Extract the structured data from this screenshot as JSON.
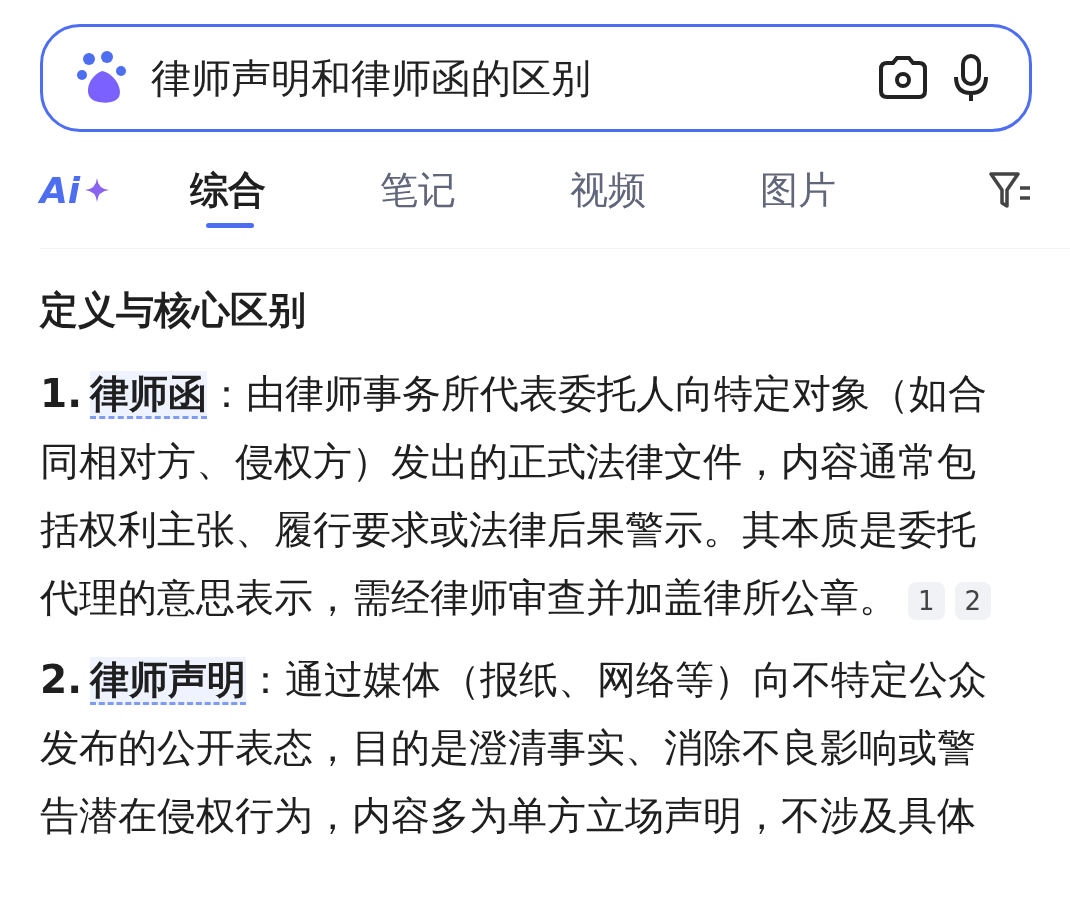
{
  "search": {
    "value": "律师声明和律师函的区别"
  },
  "ai_tab": {
    "label": "Ai"
  },
  "tabs": [
    {
      "label": "综合",
      "selected": true
    },
    {
      "label": "笔记",
      "selected": false
    },
    {
      "label": "视频",
      "selected": false
    },
    {
      "label": "图片",
      "selected": false
    }
  ],
  "heading": "定义与核心区别",
  "items": [
    {
      "number": "1.",
      "term": "律师函",
      "text": "：由律师事务所代表委托人向特定对象（如合同相对方、侵权方）发出的正式法律文件，内容通常包括权利主张、履行要求或法律后果警示。其本质是委托代理的意思表示，需经律师审查并加盖律所公章。",
      "citations": [
        "1",
        "2"
      ]
    },
    {
      "number": "2.",
      "term": "律师声明",
      "text": "：通过媒体（报纸、网络等）向不特定公众发布的公开表态，目的是澄清事实、消除不良影响或警告潜在侵权行为，内容多为单方立场声明，不涉及具体"
    }
  ]
}
